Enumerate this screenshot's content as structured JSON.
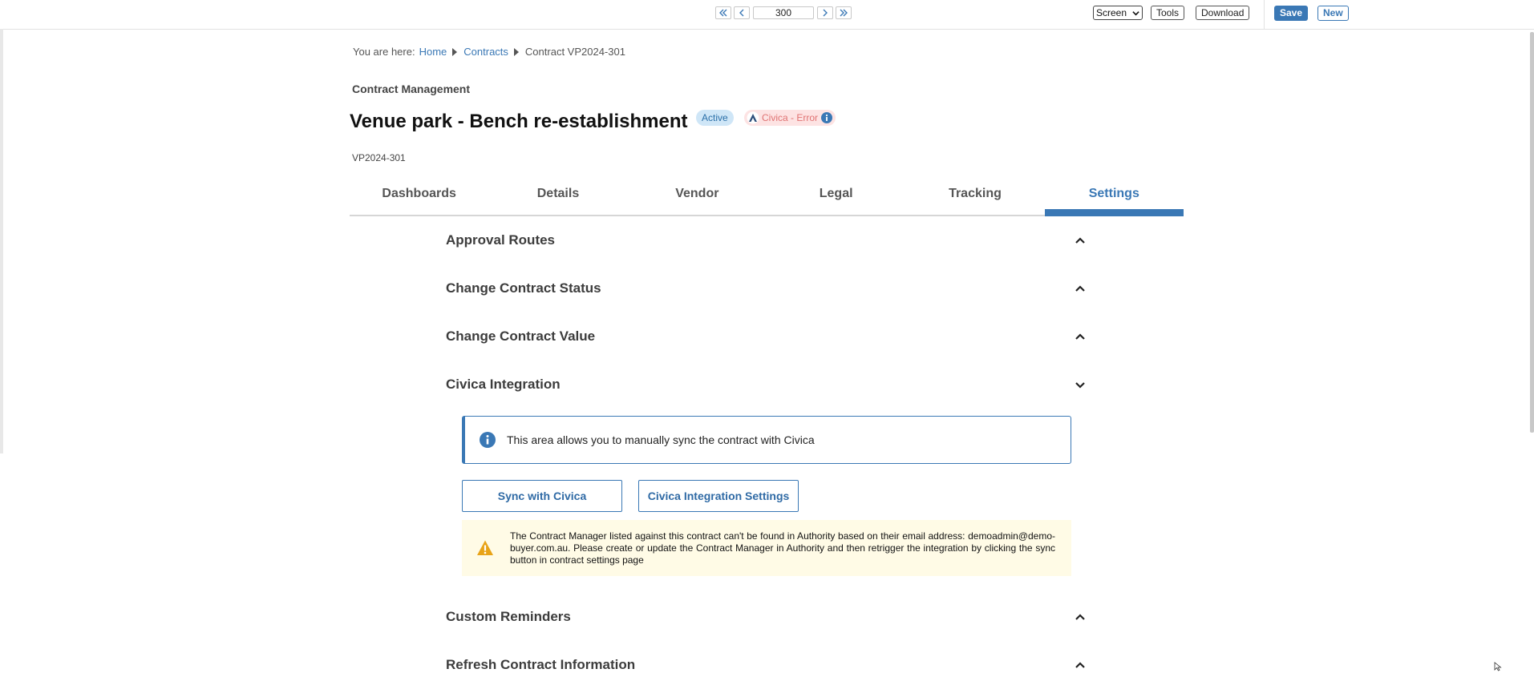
{
  "toolbar": {
    "page_number": "300",
    "view_select": "Screen",
    "tools_label": "Tools",
    "download_label": "Download",
    "save_label": "Save",
    "new_label": "New"
  },
  "breadcrumb": {
    "prefix": "You are here:",
    "items": [
      "Home",
      "Contracts",
      "Contract VP2024-301"
    ]
  },
  "header": {
    "section_label": "Contract Management",
    "title": "Venue park - Bench re-establishment",
    "status_badge": "Active",
    "integration_badge": "Civica - Error",
    "contract_code": "VP2024-301"
  },
  "tabs": [
    {
      "label": "Dashboards",
      "active": false
    },
    {
      "label": "Details",
      "active": false
    },
    {
      "label": "Vendor",
      "active": false
    },
    {
      "label": "Legal",
      "active": false
    },
    {
      "label": "Tracking",
      "active": false
    },
    {
      "label": "Settings",
      "active": true
    }
  ],
  "settings": {
    "sections": [
      {
        "title": "Approval Routes",
        "expanded": false
      },
      {
        "title": "Change Contract Status",
        "expanded": false
      },
      {
        "title": "Change Contract Value",
        "expanded": false
      },
      {
        "title": "Civica Integration",
        "expanded": true
      },
      {
        "title": "Custom Reminders",
        "expanded": false
      },
      {
        "title": "Refresh Contract Information",
        "expanded": false
      }
    ],
    "civica": {
      "info_text": "This area allows you to manually sync the contract with Civica",
      "sync_button": "Sync with Civica",
      "settings_button": "Civica Integration Settings",
      "warning_text": "The Contract Manager listed against this contract can't be found in Authority based on their email address: demoadmin@demo-buyer.com.au. Please create or update the Contract Manager in Authority and then retrigger the integration by clicking the sync button in contract settings page"
    }
  },
  "colors": {
    "accent": "#3a78b5",
    "active_badge_bg": "#cfe6f7",
    "error_badge_bg": "#fde3e3",
    "error_text": "#e07373",
    "warning_bg": "#fffbe6",
    "warning_icon": "#e8a317"
  }
}
